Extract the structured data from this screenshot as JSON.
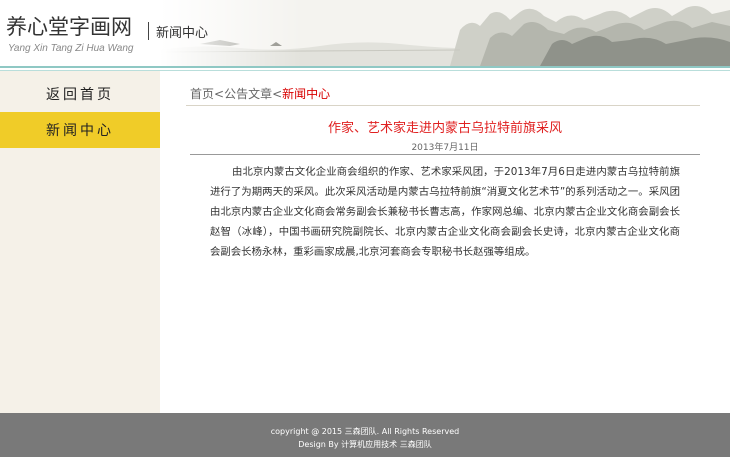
{
  "header": {
    "site_title": "养心堂字画网",
    "site_subtitle": "Yang Xin Tang Zi Hua Wang",
    "section_title": "新闻中心"
  },
  "sidebar": {
    "items": [
      {
        "label": "返回首页",
        "active": false
      },
      {
        "label": "新闻中心",
        "active": true
      }
    ]
  },
  "breadcrumb": {
    "home": "首页",
    "sep1": "<",
    "category": "公告文章",
    "sep2": "<",
    "current": "新闻中心"
  },
  "article": {
    "title": "作家、艺术家走进内蒙古乌拉特前旗采风",
    "date": "2013年7月11日",
    "body": "由北京内蒙古文化企业商会组织的作家、艺术家采风团，于2013年7月6日走进内蒙古乌拉特前旗进行了为期两天的采风。此次采风活动是内蒙古乌拉特前旗“消夏文化艺术节”的系列活动之一。采风团由北京内蒙古企业文化商会常务副会长兼秘书长曹志高，作家网总编、北京内蒙古企业文化商会副会长赵智（冰峰），中国书画研究院副院长、北京内蒙古企业文化商会副会长史诗，北京内蒙古企业文化商会副会长杨永林，重彩画家成晨,北京河套商会专职秘书长赵强等组成。"
  },
  "footer": {
    "copyright": "copyright @ 2015 三森团队. All Rights Reserved",
    "design": "Design By 计算机应用技术 三森团队"
  },
  "colors": {
    "active_nav": "#f0cc28",
    "sidebar_bg": "#f5f1e8",
    "title_red": "#e02020",
    "footer_bg": "#797979",
    "header_rule": "#8fc8c4"
  }
}
